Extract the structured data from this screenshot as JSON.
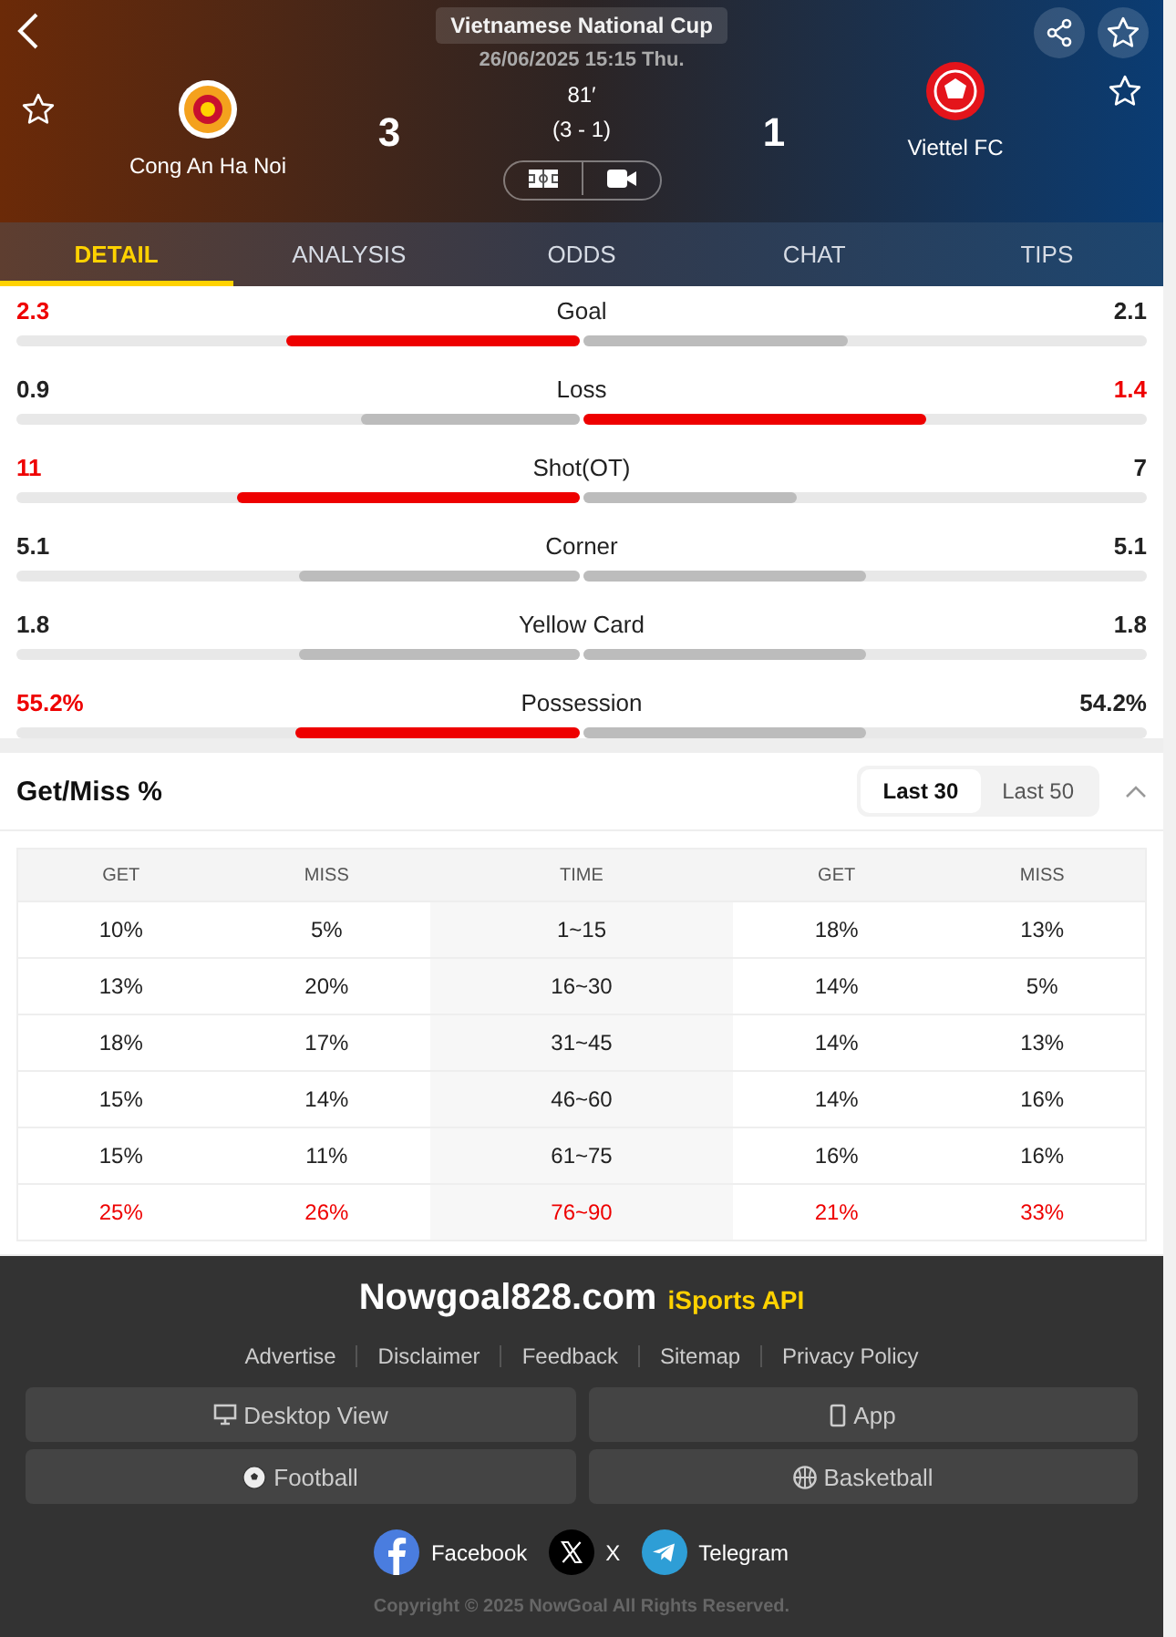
{
  "header": {
    "competition": "Vietnamese National Cup",
    "datetime": "26/06/2025 15:15 Thu.",
    "minute": "81′",
    "halftime": "(3 - 1)",
    "home": {
      "name": "Cong An Ha Noi",
      "score": "3",
      "favorite": false
    },
    "away": {
      "name": "Viettel FC",
      "score": "1",
      "favorite": false
    },
    "match_favorite": false
  },
  "tabs": [
    {
      "label": "DETAIL",
      "selected": true
    },
    {
      "label": "ANALYSIS",
      "selected": false
    },
    {
      "label": "ODDS",
      "selected": false
    },
    {
      "label": "CHAT",
      "selected": false
    },
    {
      "label": "TIPS",
      "selected": false
    }
  ],
  "stats": [
    {
      "name": "Goal",
      "home": {
        "value": "2.3",
        "level": 0.52,
        "highlight": true
      },
      "away": {
        "value": "2.1",
        "level": 0.47,
        "highlight": false
      }
    },
    {
      "name": "Loss",
      "home": {
        "value": "0.9",
        "level": 0.39,
        "highlight": false
      },
      "away": {
        "value": "1.4",
        "level": 0.61,
        "highlight": true
      }
    },
    {
      "name": "Shot(OT)",
      "home": {
        "value": "11",
        "level": 0.61,
        "highlight": true
      },
      "away": {
        "value": "7",
        "level": 0.38,
        "highlight": false
      }
    },
    {
      "name": "Corner",
      "home": {
        "value": "5.1",
        "level": 0.5,
        "highlight": false
      },
      "away": {
        "value": "5.1",
        "level": 0.5,
        "highlight": false
      }
    },
    {
      "name": "Yellow Card",
      "home": {
        "value": "1.8",
        "level": 0.5,
        "highlight": false
      },
      "away": {
        "value": "1.8",
        "level": 0.5,
        "highlight": false
      }
    },
    {
      "name": "Possession",
      "home": {
        "value": "55.2%",
        "level": 0.505,
        "highlight": true
      },
      "away": {
        "value": "54.2%",
        "level": 0.5,
        "highlight": false
      }
    }
  ],
  "get_miss": {
    "title": "Get/Miss %",
    "options": [
      {
        "label": "Last 30",
        "selected": true
      },
      {
        "label": "Last 50",
        "selected": false
      }
    ],
    "expanded": true,
    "columns": [
      "GET",
      "MISS",
      "TIME",
      "GET",
      "MISS"
    ],
    "rows": [
      {
        "cells": [
          "10%",
          "5%",
          "1~15",
          "18%",
          "13%"
        ],
        "highlight": false
      },
      {
        "cells": [
          "13%",
          "20%",
          "16~30",
          "14%",
          "5%"
        ],
        "highlight": false
      },
      {
        "cells": [
          "18%",
          "17%",
          "31~45",
          "14%",
          "13%"
        ],
        "highlight": false
      },
      {
        "cells": [
          "15%",
          "14%",
          "46~60",
          "14%",
          "16%"
        ],
        "highlight": false
      },
      {
        "cells": [
          "15%",
          "11%",
          "61~75",
          "16%",
          "16%"
        ],
        "highlight": false
      },
      {
        "cells": [
          "25%",
          "26%",
          "76~90",
          "21%",
          "33%"
        ],
        "highlight": true
      }
    ]
  },
  "footer": {
    "site": "Nowgoal828.com",
    "partner": "iSports API",
    "links": [
      "Advertise",
      "Disclaimer",
      "Feedback",
      "Sitemap",
      "Privacy Policy"
    ],
    "buttons": [
      {
        "label": "Desktop View",
        "kind": "desktop"
      },
      {
        "label": "App",
        "kind": "phone"
      },
      {
        "label": "Football",
        "kind": "football"
      },
      {
        "label": "Basketball",
        "kind": "basketball"
      }
    ],
    "social": [
      {
        "label": "Facebook",
        "kind": "facebook"
      },
      {
        "label": "X",
        "kind": "x"
      },
      {
        "label": "Telegram",
        "kind": "telegram"
      }
    ],
    "copyright": "Copyright © 2025 NowGoal All Rights Reserved."
  }
}
